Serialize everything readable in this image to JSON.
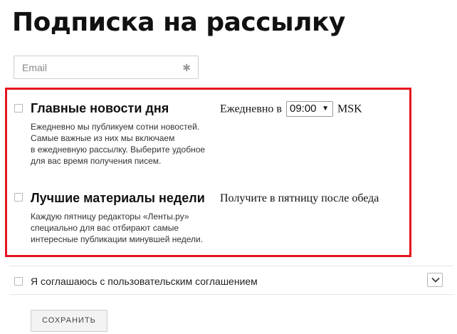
{
  "page": {
    "title": "Подписка на рассылку"
  },
  "email": {
    "placeholder": "Email",
    "required_mark": "✱"
  },
  "newsletters": [
    {
      "title": "Главные новости дня",
      "description_lines": [
        "Ежедневно мы публикуем сотни новостей.",
        "Самые важные из них мы включаем",
        "в ежедневную рассылку. Выберите удобное",
        "для вас время получения писем."
      ],
      "schedule_prefix": "Ежедневно в",
      "time_value": "09:00",
      "schedule_suffix": "MSK"
    },
    {
      "title": "Лучшие материалы недели",
      "description_lines": [
        "Каждую пятницу редакторы «Ленты.ру»",
        "специально для вас отбирают самые",
        "интересные публикации минувшей недели."
      ],
      "schedule_text": "Получите в пятницу после обеда"
    }
  ],
  "agreement": {
    "label": "Я соглашаюсь с пользовательским соглашением"
  },
  "actions": {
    "save_label": "СОХРАНИТЬ"
  },
  "colors": {
    "highlight": "#e5141f"
  }
}
